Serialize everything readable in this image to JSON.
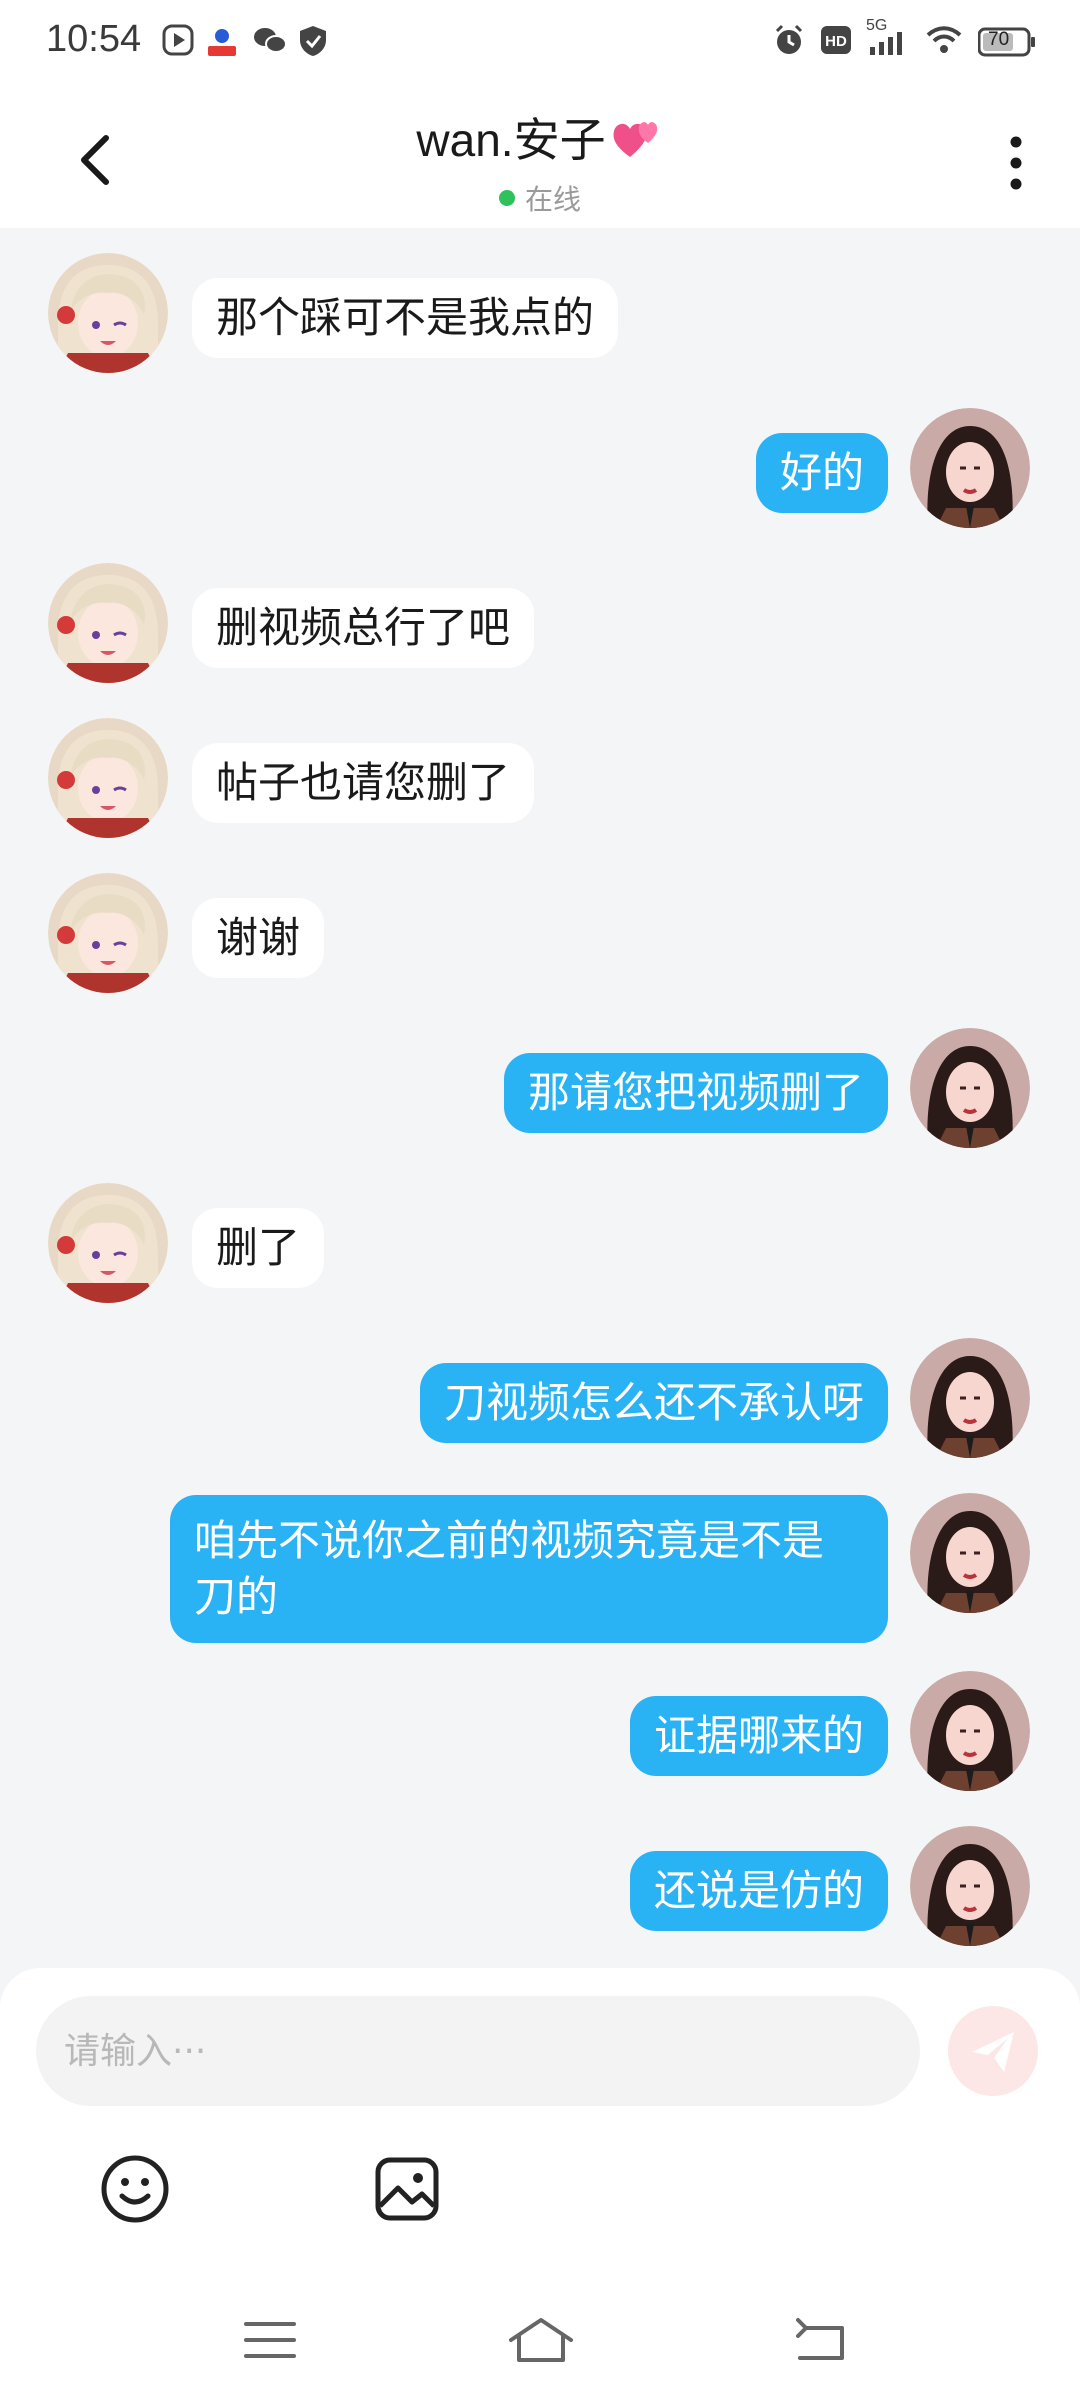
{
  "status_bar": {
    "time": "10:54",
    "battery": "70",
    "network": "5G"
  },
  "header": {
    "title": "wan.安子",
    "status": "在线"
  },
  "messages": [
    {
      "side": "left",
      "text": "那个踩可不是我点的"
    },
    {
      "side": "right",
      "text": "好的"
    },
    {
      "side": "left",
      "text": "删视频总行了吧"
    },
    {
      "side": "left",
      "text": "帖子也请您删了"
    },
    {
      "side": "left",
      "text": "谢谢"
    },
    {
      "side": "right",
      "text": "那请您把视频删了"
    },
    {
      "side": "left",
      "text": "删了"
    },
    {
      "side": "right",
      "text": "刀视频怎么还不承认呀"
    },
    {
      "side": "right",
      "text": "咱先不说你之前的视频究竟是不是刀的"
    },
    {
      "side": "right",
      "text": "证据哪来的"
    },
    {
      "side": "right",
      "text": "还说是仿的"
    }
  ],
  "input": {
    "placeholder": "请输入···"
  },
  "colors": {
    "bubble_self": "#29b3f4",
    "bubble_other": "#ffffff",
    "online_dot": "#2fc25b"
  }
}
